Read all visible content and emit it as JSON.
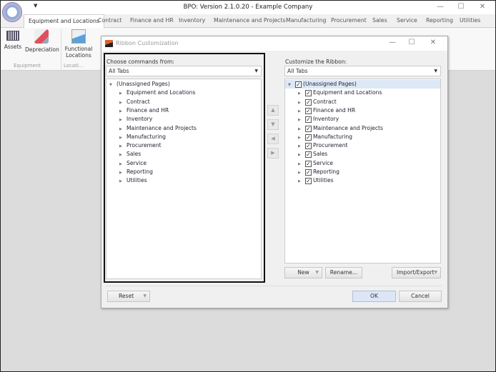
{
  "app": {
    "title": "BPO: Version 2.1.0.20 - Example Company",
    "qat_icon": "dropdown-arrow-icon",
    "logo": "gauge-logo-icon"
  },
  "window_controls": {
    "minimize": "—",
    "maximize": "☐",
    "close": "✕"
  },
  "tabs": [
    "Equipment and Locations",
    "Contract",
    "Finance and HR",
    "Inventory",
    "Maintenance and Projects",
    "Manufacturing",
    "Procurement",
    "Sales",
    "Service",
    "Reporting",
    "Utilities"
  ],
  "ribbon": {
    "buttons": [
      {
        "label": "Assets",
        "icon": "barcode-icon"
      },
      {
        "label": "Depreciation",
        "icon": "percent-eraser-icon"
      },
      {
        "label": "Functional Locations",
        "icon": "area-chart-icon"
      }
    ],
    "groups": [
      "Equipment",
      "Locati..."
    ]
  },
  "dialog": {
    "title": "Ribbon Customization",
    "left": {
      "label": "Choose commands from:",
      "dropdown": "All Tabs",
      "root": "(Unassigned Pages)",
      "items": [
        "Equipment and Locations",
        "Contract",
        "Finance and HR",
        "Inventory",
        "Maintenance and Projects",
        "Manufacturing",
        "Procurement",
        "Sales",
        "Service",
        "Reporting",
        "Utilities"
      ]
    },
    "right": {
      "label": "Customize the Ribbon:",
      "dropdown": "All Tabs",
      "root": "(Unassigned Pages)",
      "items": [
        "Equipment and Locations",
        "Contract",
        "Finance and HR",
        "Inventory",
        "Maintenance and Projects",
        "Manufacturing",
        "Procurement",
        "Sales",
        "Service",
        "Reporting",
        "Utilities"
      ],
      "all_checked": true
    },
    "move_buttons": [
      "move-up-icon",
      "move-down-icon",
      "move-left-icon",
      "move-right-icon"
    ],
    "buttons": {
      "new": "New",
      "rename": "Rename...",
      "import_export": "Import/Export",
      "reset": "Reset",
      "ok": "OK",
      "cancel": "Cancel"
    },
    "colors": {
      "selected_row": "#dde8f6",
      "ok_button": "#dce6f7"
    }
  }
}
